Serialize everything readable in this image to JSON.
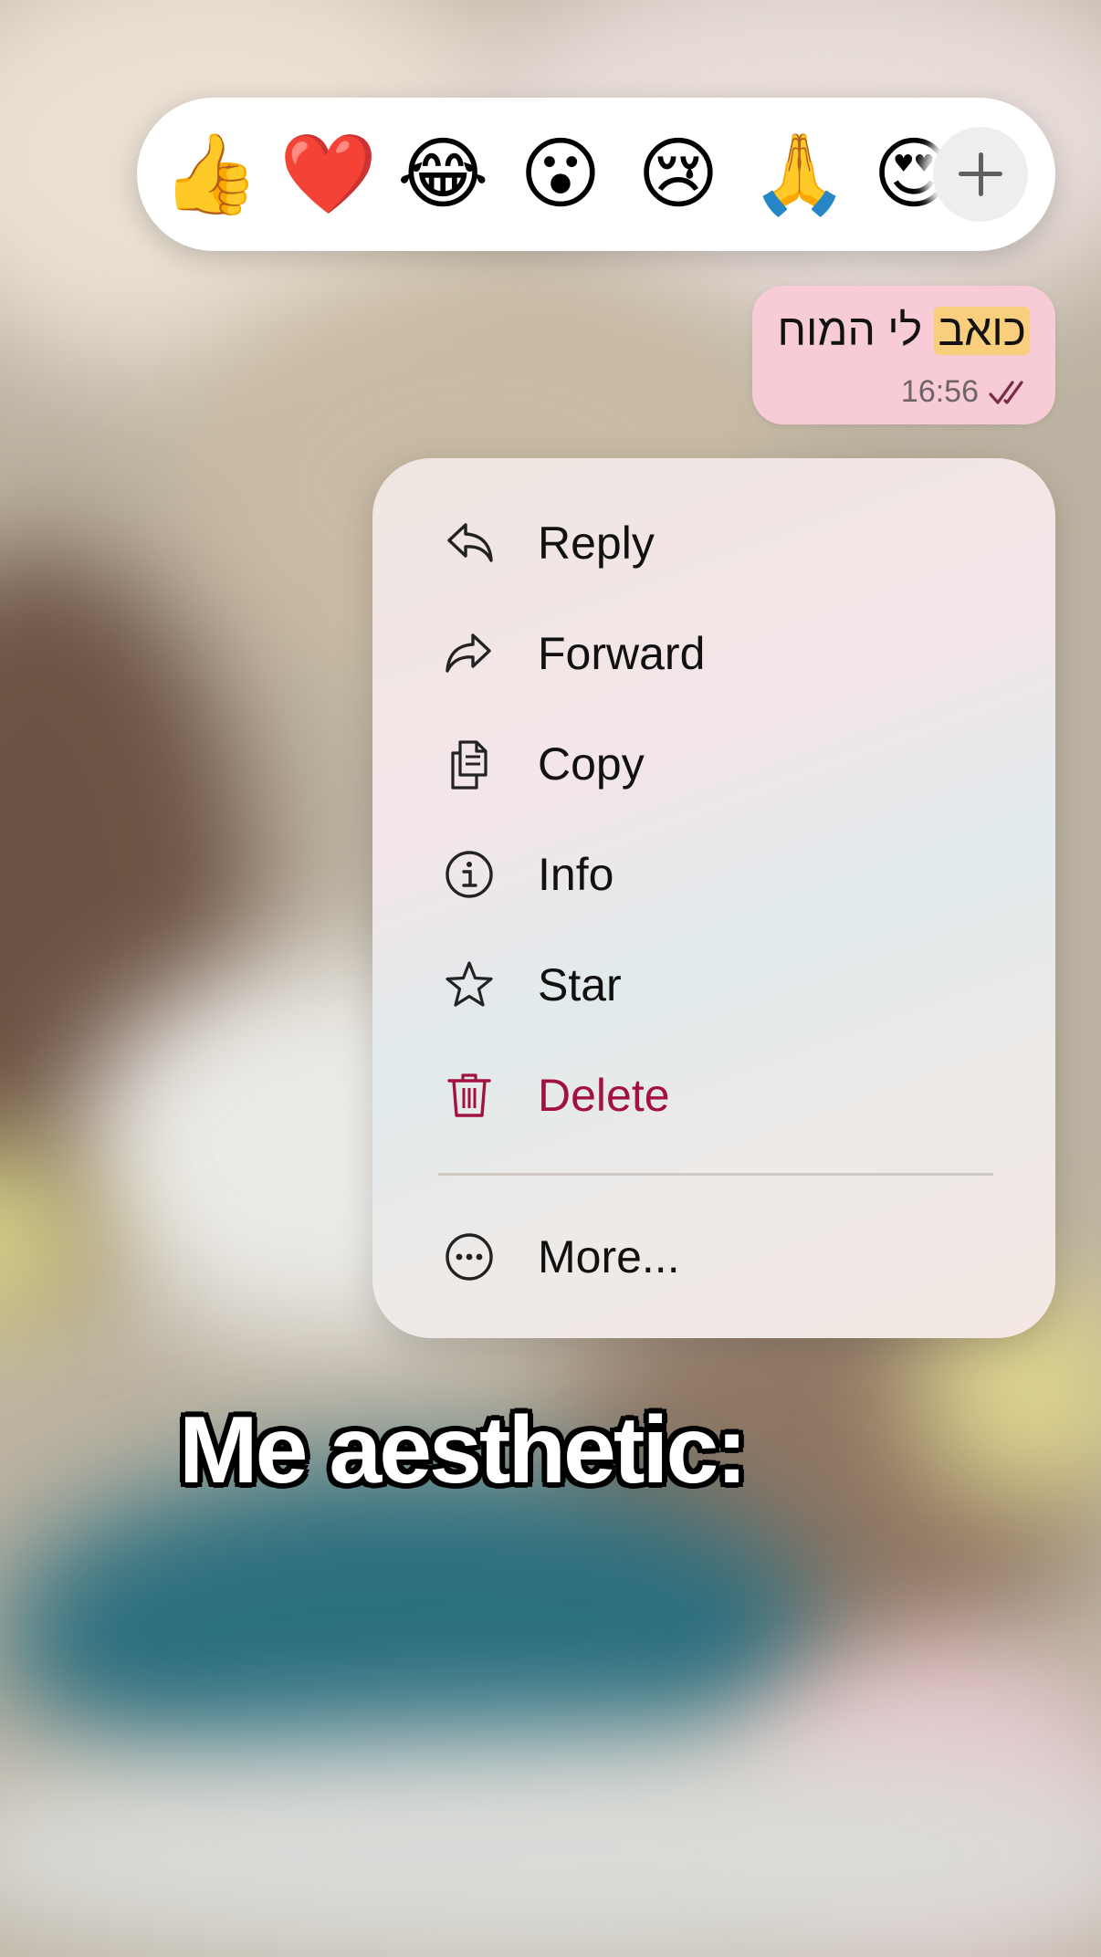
{
  "reactions": {
    "emojis": [
      {
        "glyph": "👍",
        "name": "thumbs-up"
      },
      {
        "glyph": "❤️",
        "name": "red-heart"
      },
      {
        "glyph": "😂",
        "name": "tears-of-joy"
      },
      {
        "glyph": "😮",
        "name": "surprised"
      },
      {
        "glyph": "😢",
        "name": "crying"
      },
      {
        "glyph": "🙏",
        "name": "folded-hands"
      },
      {
        "glyph": "😍",
        "name": "heart-eyes"
      }
    ],
    "more_icon": "plus-icon"
  },
  "message": {
    "text_highlight": "כואב",
    "text_rest": " לי המוח",
    "time": "16:56",
    "status_icon": "double-check-icon",
    "bubble_color": "#f7ccd6",
    "highlight_color": "#f9cf7d"
  },
  "menu": {
    "items": [
      {
        "label": "Reply",
        "icon": "reply-icon"
      },
      {
        "label": "Forward",
        "icon": "forward-icon"
      },
      {
        "label": "Copy",
        "icon": "copy-icon"
      },
      {
        "label": "Info",
        "icon": "info-icon"
      },
      {
        "label": "Star",
        "icon": "star-icon"
      },
      {
        "label": "Delete",
        "icon": "trash-icon",
        "color": "#a3123f"
      },
      {
        "label": "More...",
        "icon": "more-icon"
      }
    ]
  },
  "caption": "Me aesthetic:"
}
